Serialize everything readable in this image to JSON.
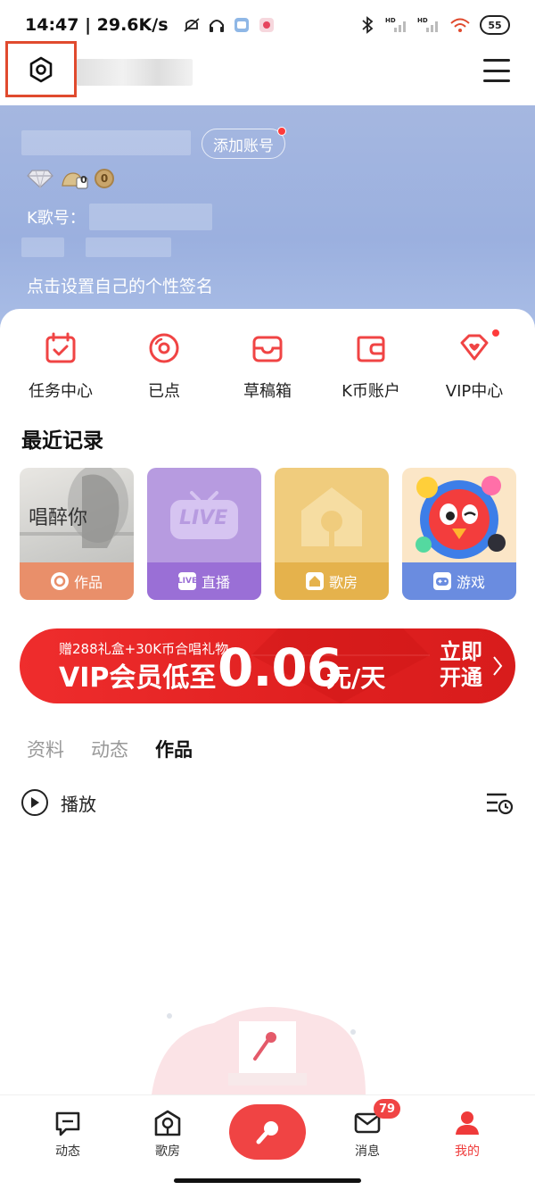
{
  "status_bar": {
    "time_speed": "14:47 | 29.6K/s",
    "battery": "55",
    "hd_label": "HD"
  },
  "header": {
    "add_account_label": "添加账号",
    "kge_label": "K歌号：",
    "signature_placeholder": "点击设置自己的个性签名",
    "coin_value_1": "0",
    "coin_value_2": "0"
  },
  "quick_actions": [
    {
      "label": "任务中心",
      "icon": "calendar-check-icon"
    },
    {
      "label": "已点",
      "icon": "vinyl-disc-icon"
    },
    {
      "label": "草稿箱",
      "icon": "inbox-tray-icon"
    },
    {
      "label": "K币账户",
      "icon": "wallet-icon"
    },
    {
      "label": "VIP中心",
      "icon": "vip-heart-icon"
    }
  ],
  "recent": {
    "title": "最近记录",
    "cards": [
      {
        "label": "作品",
        "icon": "disc-icon",
        "cover_text": "唱醉你"
      },
      {
        "label": "直播",
        "icon": "live-icon",
        "cover_text": "LIVE"
      },
      {
        "label": "歌房",
        "icon": "house-icon"
      },
      {
        "label": "游戏",
        "icon": "gamepad-icon"
      }
    ]
  },
  "vip_banner": {
    "subtitle": "赠288礼盒+30K币合唱礼物",
    "main": "VIP会员低至",
    "price": "0.06",
    "unit": "元/天",
    "cta": "立即开通"
  },
  "tabs": [
    {
      "label": "资料"
    },
    {
      "label": "动态"
    },
    {
      "label": "作品"
    }
  ],
  "play_label": "播放",
  "bottom_nav": {
    "feed": "动态",
    "room": "歌房",
    "messages": "消息",
    "messages_count": "79",
    "me": "我的"
  },
  "colors": {
    "accent": "#f04444",
    "header_bg": "#a5b7e0",
    "highlight_box": "#e04a2e"
  }
}
